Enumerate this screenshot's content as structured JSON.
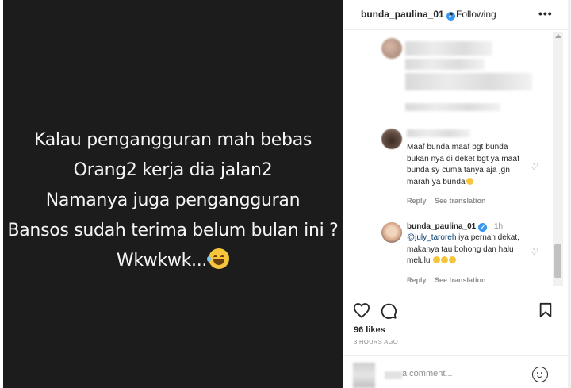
{
  "media": {
    "lines": [
      "Kalau pengangguran mah bebas",
      "Orang2 kerja dia jalan2",
      "Namanya juga pengangguran",
      "Bansos sudah terima belum bulan ini ?",
      "Wkwkwk..."
    ],
    "emoji": "face-with-tears-of-joy"
  },
  "header": {
    "username": "bunda_paulina_01",
    "verified_mark": "✓",
    "separator": "•",
    "follow_status": "Following",
    "more": "•••"
  },
  "comments": [
    {
      "text": "Maaf bunda maaf bgt bunda bukan nya di deket bgt ya maaf bunda sy cuma tanya aja jgn marah ya bunda",
      "reply": "Reply",
      "see_translation": "See translation"
    },
    {
      "username": "bunda_paulina_01",
      "time": "1h",
      "mention": "@july_taroreh",
      "text": " iya pernah dekat, makanya tau bohong dan halu melulu",
      "reply": "Reply",
      "see_translation": "See translation"
    }
  ],
  "actions": {
    "likes": "96 likes",
    "time_ago": "3 HOURS AGO"
  },
  "add_comment": {
    "placeholder": "a comment..."
  },
  "colors": {
    "media_bg": "#1c1c1c",
    "verified": "#3897f0",
    "mention": "#00376b",
    "muted": "#8e8e8e"
  }
}
